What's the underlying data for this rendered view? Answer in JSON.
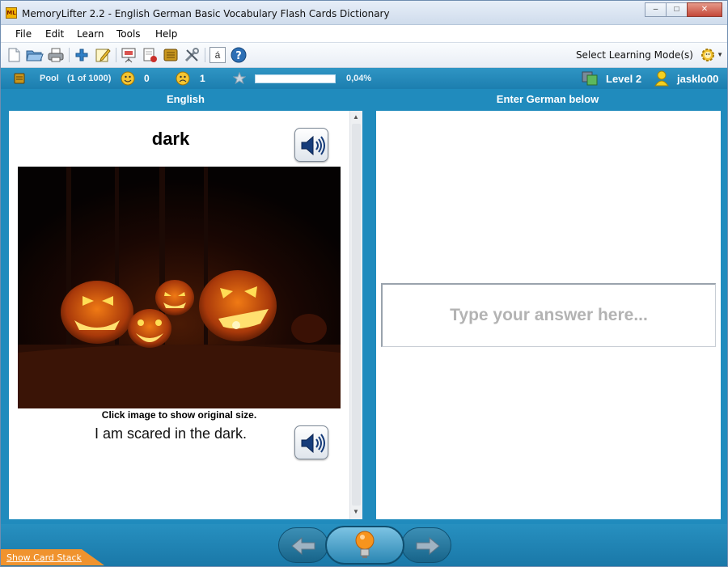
{
  "window": {
    "app_icon_text": "ML",
    "title": "MemoryLifter 2.2 - English German Basic Vocabulary Flash Cards Dictionary",
    "controls": [
      "minimize",
      "maximize",
      "close"
    ]
  },
  "menu": [
    "File",
    "Edit",
    "Learn",
    "Tools",
    "Help"
  ],
  "toolbar": {
    "icons": [
      "new-file-icon",
      "open-folder-icon",
      "print-icon",
      "add-card-icon",
      "edit-card-icon",
      "presentation-icon",
      "card-delete-icon",
      "card-box-icon",
      "settings-tools-icon",
      "special-characters-icon",
      "help-icon"
    ],
    "special_char_label": "á",
    "mode_label": "Select Learning Mode(s)"
  },
  "status": {
    "pool_label": "Pool",
    "pool_count": "(1 of 1000)",
    "correct_count": "0",
    "wrong_count": "1",
    "progress_percent": 0.04,
    "progress_label": "0,04%",
    "level_label": "Level 2",
    "user_name": "jasklo00"
  },
  "question": {
    "header": "English",
    "word": "dark",
    "image_caption": "Click image to show original size.",
    "example_sentence": "I am scared in the dark."
  },
  "answer": {
    "header": "Enter German below",
    "placeholder": "Type your answer here..."
  },
  "bottom": {
    "show_card_stack": "Show Card Stack"
  },
  "colors": {
    "accent_blue": "#208bbd",
    "tab_orange": "#f0932e",
    "bulb_orange": "#f7941d"
  }
}
